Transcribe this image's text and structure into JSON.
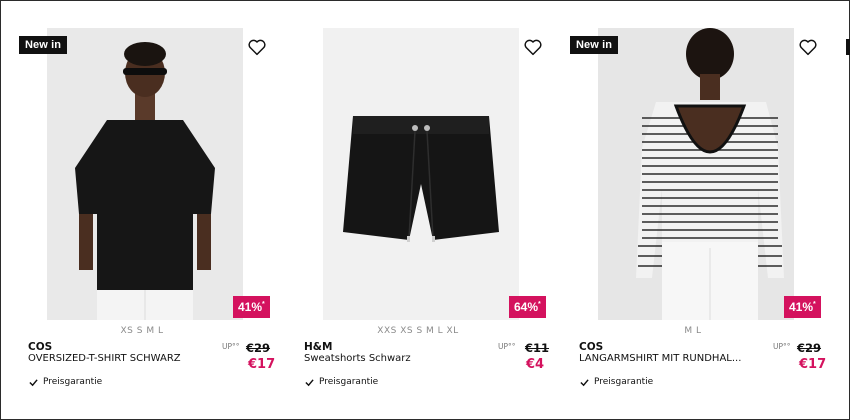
{
  "products": [
    {
      "badge": "New in",
      "brand": "COS",
      "title": "OVERSIZED-T-SHIRT SCHWARZ",
      "sizes": "XS S M L",
      "up_label": "UP°°",
      "old_price": "€29",
      "new_price": "€17",
      "discount": "41%",
      "discount_mark": "*",
      "guarantee": "Preisgarantie",
      "image": "model-black-tshirt"
    },
    {
      "badge": "",
      "brand": "H&M",
      "title": "Sweatshorts Schwarz",
      "sizes": "XXS XS S M L XL",
      "up_label": "UP°°",
      "old_price": "€11",
      "new_price": "€4",
      "discount": "64%",
      "discount_mark": "*",
      "guarantee": "Preisgarantie",
      "image": "black-sweatshorts"
    },
    {
      "badge": "New in",
      "brand": "COS",
      "title": "LANGARMSHIRT MIT RUNDHAL...",
      "sizes": "M L",
      "up_label": "UP°°",
      "old_price": "€29",
      "new_price": "€17",
      "discount": "41%",
      "discount_mark": "*",
      "guarantee": "Preisgarantie",
      "image": "model-striped-longsleeve"
    }
  ],
  "icons": {
    "favorite": "heart-icon",
    "check": "check-icon"
  },
  "colors": {
    "accent": "#d4125e",
    "badge_bg": "#111111",
    "text": "#111111",
    "muted": "#8a8a8a"
  }
}
